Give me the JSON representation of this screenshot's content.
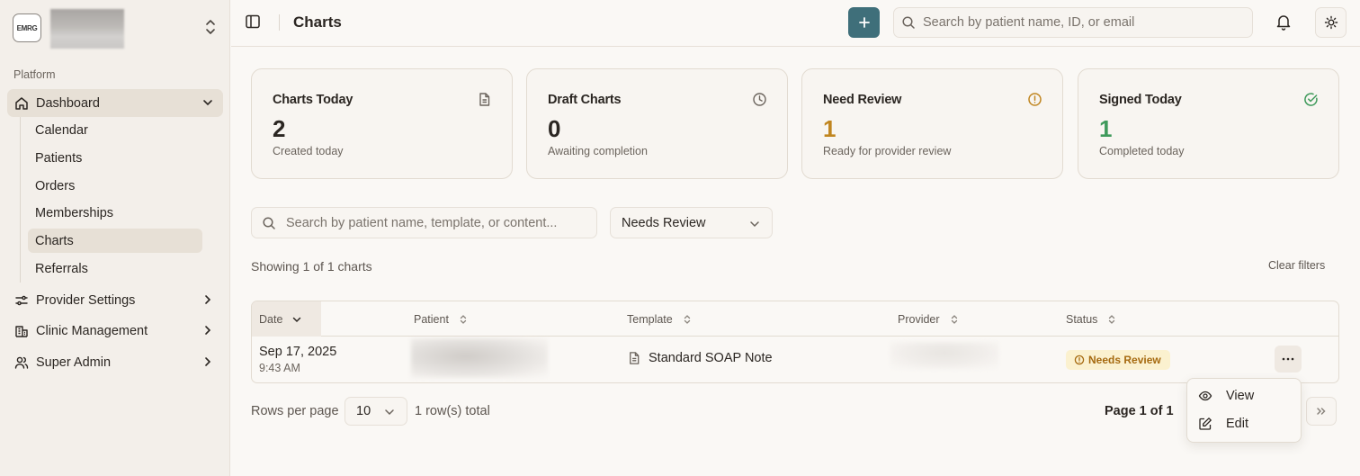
{
  "sidebar": {
    "org_logo": "EMRG",
    "section_label": "Platform",
    "dashboard": "Dashboard",
    "sub_items": [
      "Calendar",
      "Patients",
      "Orders",
      "Memberships",
      "Charts",
      "Referrals"
    ],
    "provider_settings": "Provider Settings",
    "clinic_management": "Clinic Management",
    "super_admin": "Super Admin"
  },
  "header": {
    "title": "Charts",
    "search_placeholder": "Search by patient name, ID, or email"
  },
  "cards": [
    {
      "title": "Charts Today",
      "value": "2",
      "subtitle": "Created today",
      "icon": "file-text-icon",
      "color": "#2b2622"
    },
    {
      "title": "Draft Charts",
      "value": "0",
      "subtitle": "Awaiting completion",
      "icon": "clock-icon",
      "color": "#2b2622"
    },
    {
      "title": "Need Review",
      "value": "1",
      "subtitle": "Ready for provider review",
      "icon": "alert-circle-icon",
      "color": "#c0851f"
    },
    {
      "title": "Signed Today",
      "value": "1",
      "subtitle": "Completed today",
      "icon": "check-circle-icon",
      "color": "#3f9a5b"
    }
  ],
  "filters": {
    "search_placeholder": "Search by patient name, template, or content...",
    "status_value": "Needs Review",
    "showing_text": "Showing 1 of 1 charts",
    "clear_label": "Clear filters"
  },
  "table": {
    "columns": [
      "Date",
      "Patient",
      "Template",
      "Provider",
      "Status"
    ],
    "rows": [
      {
        "date": "Sep 17, 2025",
        "time": "9:43 AM",
        "template": "Standard SOAP Note",
        "status": "Needs Review"
      }
    ]
  },
  "footer": {
    "rows_per_page_label": "Rows per page",
    "rows_per_page_value": "10",
    "total_text": "1 row(s) total",
    "page_text": "Page 1 of 1"
  },
  "row_menu": {
    "view_label": "View",
    "edit_label": "Edit"
  },
  "colors": {
    "accent": "#3f6f7a",
    "warning": "#c0851f",
    "success": "#3f9a5b",
    "badge_bg": "#fbf1cf"
  }
}
